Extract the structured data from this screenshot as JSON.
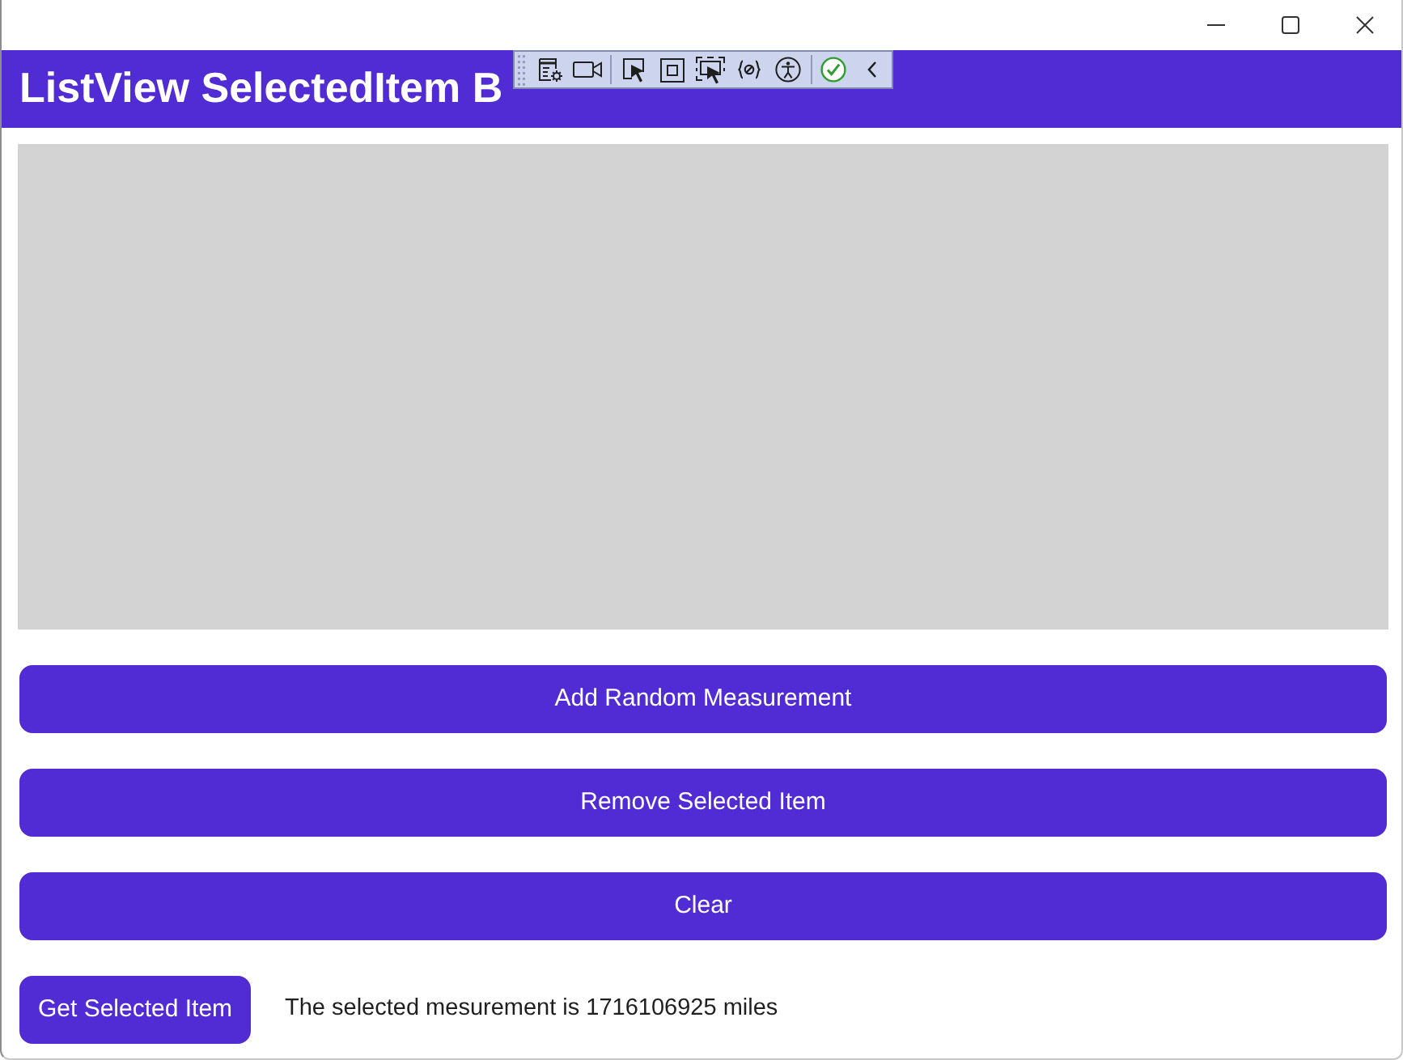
{
  "header": {
    "title": "ListView SelectedItem B"
  },
  "buttons": [
    "Add Random Measurement",
    "Remove Selected Item",
    "Clear"
  ],
  "footer": {
    "button": "Get Selected Item",
    "message": "The selected mesurement is 1716106925 miles"
  }
}
